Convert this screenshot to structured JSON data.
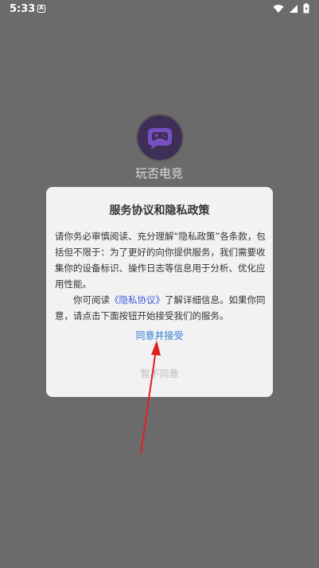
{
  "status_bar": {
    "time": "5:33",
    "notification_glyph": "A"
  },
  "app": {
    "name": "玩否电竞",
    "logo_icon": "gamepad-chat-bubble-icon"
  },
  "dialog": {
    "title": "服务协议和隐私政策",
    "paragraph1": "请你务必审慎阅读、充分理解“隐私政策”各条款，包括但不限于：为了更好的向你提供服务，我们需要收集你的设备标识、操作日志等信息用于分析、优化应用性能。",
    "paragraph2_before": "你可阅读",
    "paragraph2_link": "《隐私协议》",
    "paragraph2_after": "了解详细信息。如果你同意，请点击下面按钮开始接受我们的服务。",
    "accept_label": "同意并接受",
    "decline_label": "暂不同意"
  },
  "colors": {
    "overlay": "#6b6b6b",
    "dialog_bg": "#f2f2f2",
    "accept": "#2b7bd1",
    "link": "#3a5bd9",
    "decline": "#bcbcbc",
    "annotation": "#e02020"
  }
}
